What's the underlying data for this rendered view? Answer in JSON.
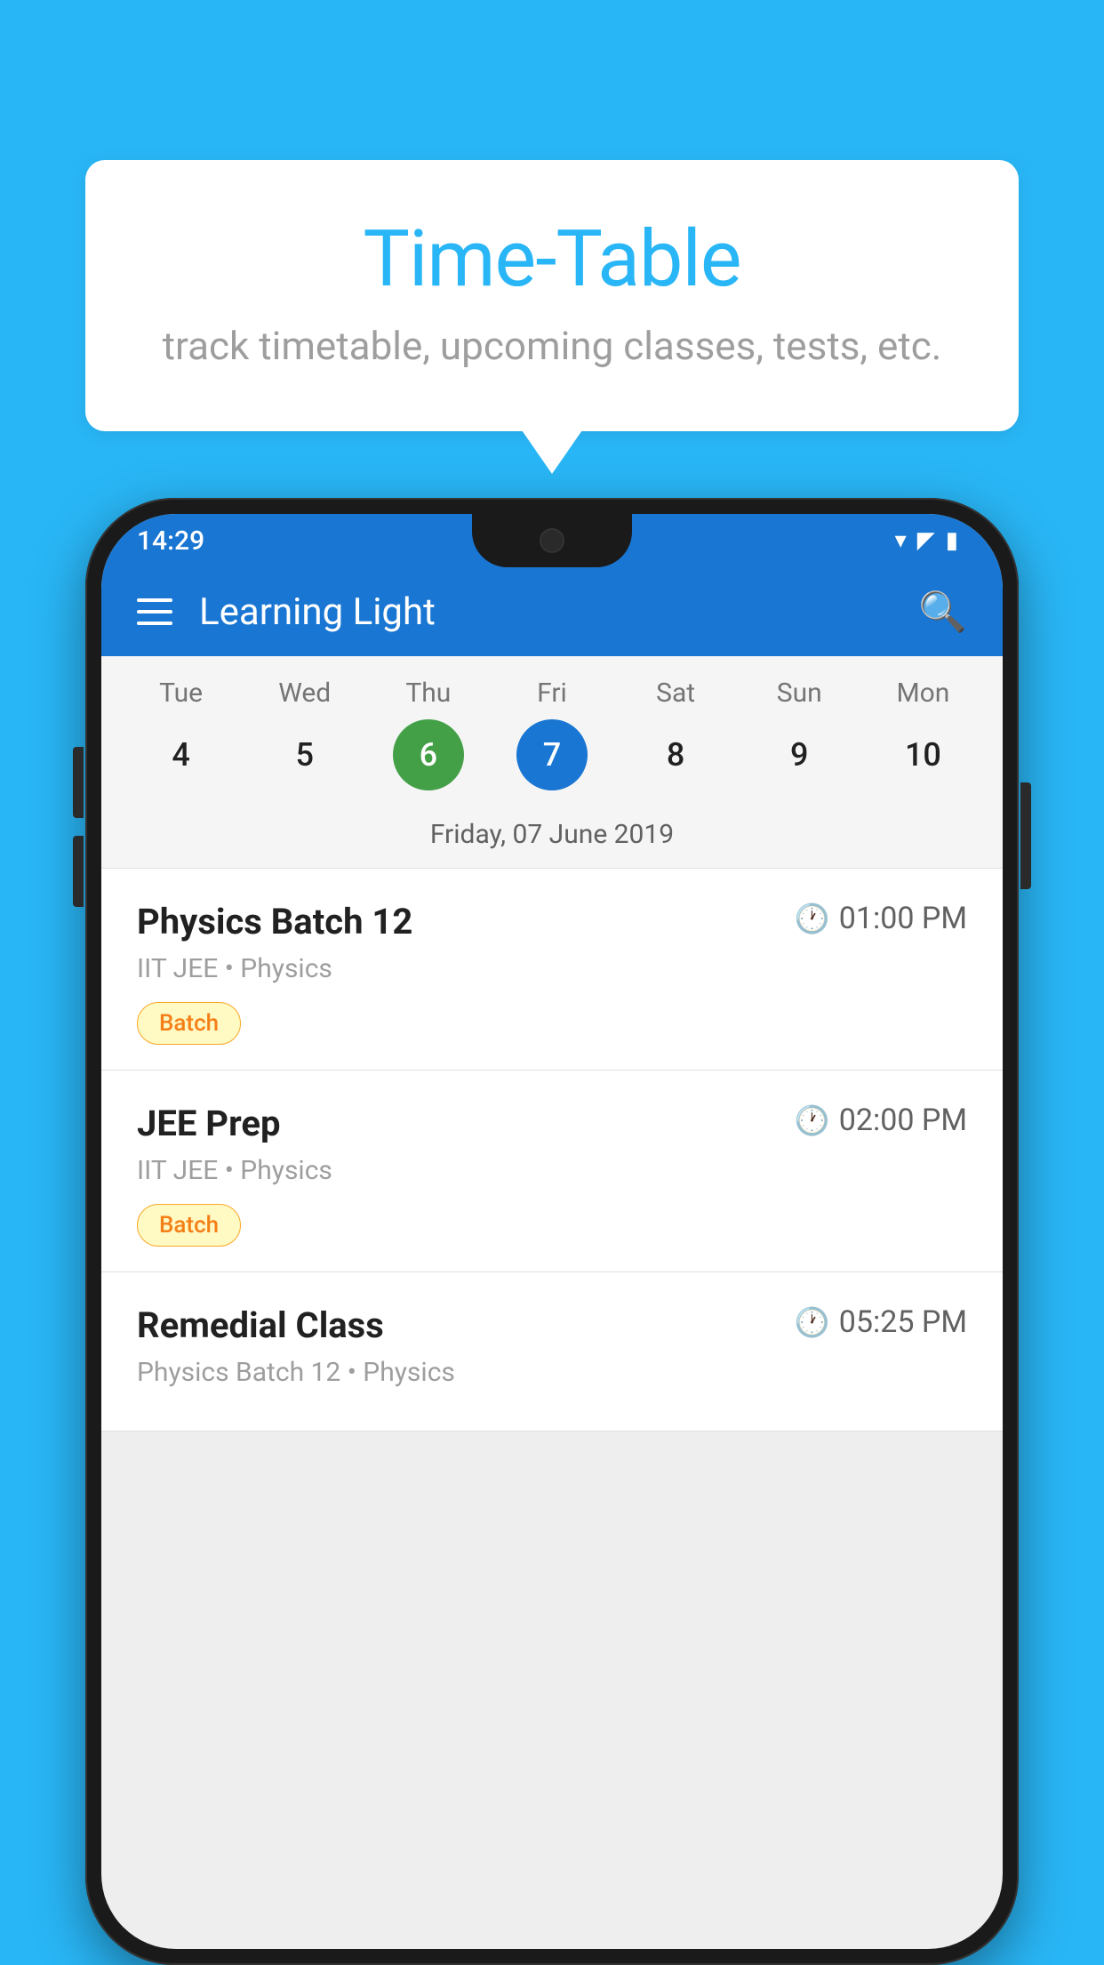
{
  "background_color": "#29B6F6",
  "speech_bubble": {
    "title": "Time-Table",
    "subtitle": "track timetable, upcoming classes, tests, etc."
  },
  "status_bar": {
    "time": "14:29",
    "icons": [
      "wifi",
      "signal",
      "battery"
    ]
  },
  "app_bar": {
    "title": "Learning Light",
    "menu_icon_label": "menu",
    "search_icon_label": "search"
  },
  "calendar": {
    "days": [
      {
        "label": "Tue",
        "number": "4",
        "state": "normal"
      },
      {
        "label": "Wed",
        "number": "5",
        "state": "normal"
      },
      {
        "label": "Thu",
        "number": "6",
        "state": "today"
      },
      {
        "label": "Fri",
        "number": "7",
        "state": "selected"
      },
      {
        "label": "Sat",
        "number": "8",
        "state": "normal"
      },
      {
        "label": "Sun",
        "number": "9",
        "state": "normal"
      },
      {
        "label": "Mon",
        "number": "10",
        "state": "normal"
      }
    ],
    "selected_date_label": "Friday, 07 June 2019"
  },
  "schedule": {
    "items": [
      {
        "title": "Physics Batch 12",
        "time": "01:00 PM",
        "subtitle": "IIT JEE • Physics",
        "badge": "Batch"
      },
      {
        "title": "JEE Prep",
        "time": "02:00 PM",
        "subtitle": "IIT JEE • Physics",
        "badge": "Batch"
      },
      {
        "title": "Remedial Class",
        "time": "05:25 PM",
        "subtitle": "Physics Batch 12 • Physics",
        "badge": null
      }
    ]
  }
}
